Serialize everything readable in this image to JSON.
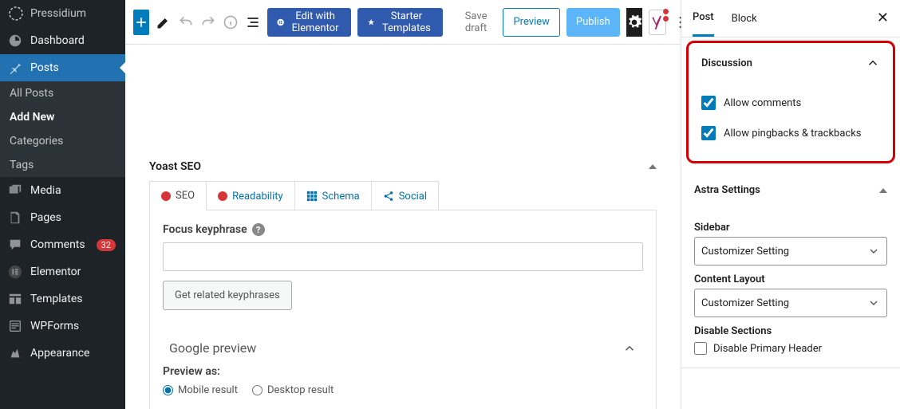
{
  "brand": "Pressidium",
  "nav": {
    "dashboard": "Dashboard",
    "posts": "Posts",
    "posts_sub": [
      "All Posts",
      "Add New",
      "Categories",
      "Tags"
    ],
    "media": "Media",
    "pages": "Pages",
    "comments": "Comments",
    "comments_badge": "32",
    "elementor": "Elementor",
    "templates": "Templates",
    "wpforms": "WPForms",
    "appearance": "Appearance"
  },
  "toolbar": {
    "elementor": "Edit with Elementor",
    "starter": "Starter Templates",
    "save_draft": "Save draft",
    "preview": "Preview",
    "publish": "Publish"
  },
  "yoast": {
    "title": "Yoast SEO",
    "tabs": {
      "seo": "SEO",
      "read": "Readability",
      "schema": "Schema",
      "social": "Social"
    },
    "focus_label": "Focus keyphrase",
    "focus_value": "",
    "related_btn": "Get related keyphrases",
    "google_preview": "Google preview",
    "preview_as": "Preview as:",
    "mobile": "Mobile result",
    "desktop": "Desktop result"
  },
  "sidebar": {
    "tabs": {
      "post": "Post",
      "block": "Block"
    },
    "discussion": {
      "title": "Discussion",
      "allow_comments": "Allow comments",
      "allow_pings": "Allow pingbacks & trackbacks"
    },
    "astra": {
      "title": "Astra Settings",
      "sidebar_label": "Sidebar",
      "sidebar_value": "Customizer Setting",
      "layout_label": "Content Layout",
      "layout_value": "Customizer Setting",
      "disable_label": "Disable Sections",
      "disable_primary": "Disable Primary Header"
    }
  }
}
